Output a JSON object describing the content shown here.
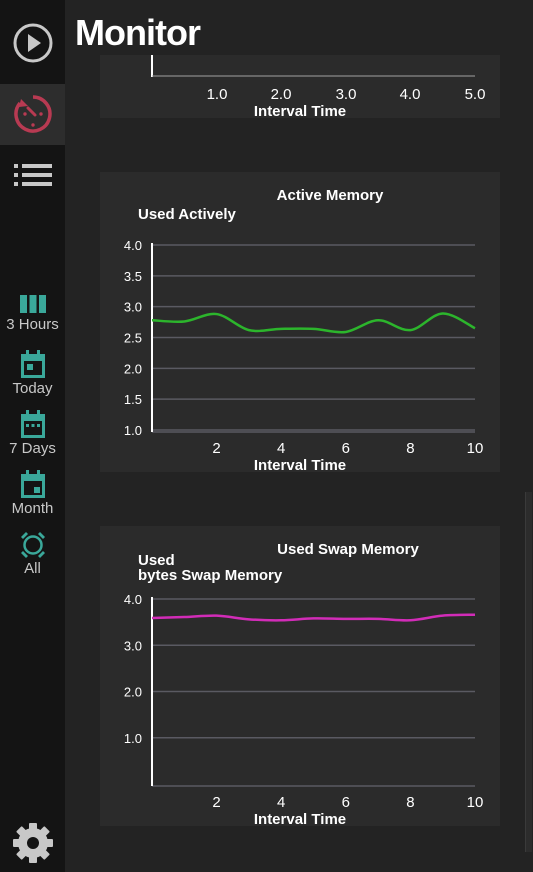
{
  "page": {
    "title": "Monitor"
  },
  "sidebar": {
    "top_buttons": [
      {
        "icon": "play-circle-icon"
      },
      {
        "icon": "gauge-icon"
      },
      {
        "icon": "list-icon"
      }
    ],
    "ranges": [
      {
        "icon": "columns-icon",
        "label": "3 Hours"
      },
      {
        "icon": "calendar-today-icon",
        "label": "Today"
      },
      {
        "icon": "calendar-week-icon",
        "label": "7 Days"
      },
      {
        "icon": "calendar-month-icon",
        "label": "Month"
      },
      {
        "icon": "all-time-icon",
        "label": "All"
      }
    ],
    "settings_icon": "gear-icon"
  },
  "colors": {
    "accent_teal": "#3aa89a",
    "active_red": "#b83a52",
    "active_memory_line": "#2cb52c",
    "swap_memory_line": "#d22cb8"
  },
  "chart_data": [
    {
      "type": "line",
      "partial": true,
      "xlabel": "Interval Time",
      "x_ticks": [
        "1.0",
        "2.0",
        "3.0",
        "4.0",
        "5.0"
      ]
    },
    {
      "type": "line",
      "title": "Active Memory",
      "ylabel": "Used Actively",
      "xlabel": "Interval Time",
      "ylim": [
        1.0,
        4.0
      ],
      "y_ticks": [
        "4.0",
        "3.5",
        "3.0",
        "2.5",
        "2.0",
        "1.5",
        "1.0"
      ],
      "x_ticks": [
        "2",
        "4",
        "6",
        "8",
        "10"
      ],
      "grid": true,
      "series": [
        {
          "x": [
            0,
            1,
            2,
            3,
            4,
            5,
            6,
            7,
            8,
            9,
            10
          ],
          "y": [
            2.78,
            2.76,
            2.88,
            2.62,
            2.64,
            2.64,
            2.59,
            2.78,
            2.62,
            2.89,
            2.65
          ]
        }
      ]
    },
    {
      "type": "line",
      "title": "Used Swap Memory",
      "ylabel_lines": [
        "Used",
        "bytes Swap Memory"
      ],
      "xlabel": "Interval Time",
      "ylim": [
        0,
        4.0
      ],
      "y_ticks": [
        "4.0",
        "3.0",
        "2.0",
        "1.0"
      ],
      "x_ticks": [
        "2",
        "4",
        "6",
        "8",
        "10"
      ],
      "grid": true,
      "series": [
        {
          "x": [
            0,
            1,
            2,
            3,
            4,
            5,
            6,
            7,
            8,
            9,
            10
          ],
          "y": [
            3.59,
            3.61,
            3.64,
            3.56,
            3.54,
            3.58,
            3.57,
            3.57,
            3.54,
            3.64,
            3.66
          ]
        }
      ]
    }
  ]
}
